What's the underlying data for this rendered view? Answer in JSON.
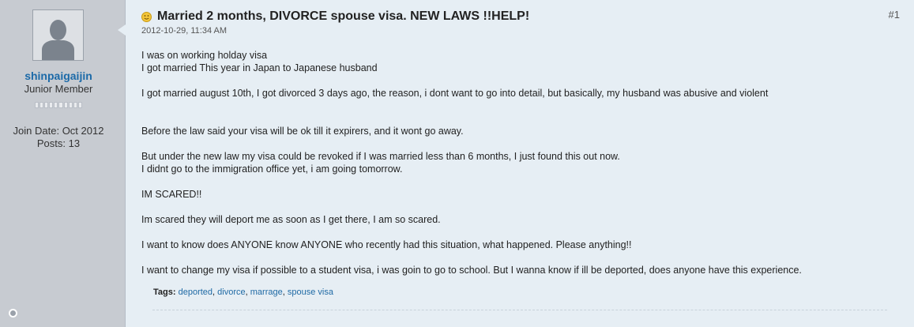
{
  "user": {
    "username": "shinpaigaijin",
    "title": "Junior Member",
    "reputation_segments": 10,
    "join_date": "Join Date: Oct 2012",
    "posts": "Posts: 13"
  },
  "post": {
    "counter": "#1",
    "title": "Married 2 months, DIVORCE spouse visa. NEW LAWS !!HELP!",
    "date": "2012-10-29, 11:34 AM",
    "body": [
      "I was on working holday visa",
      "I got married This year in Japan to Japanese husband",
      "I got married august 10th, I got divorced 3 days ago, the reason, i dont want to go into detail, but basically, my husband was abusive and violent",
      "Before the law said your visa will be ok till it expirers, and it wont go away.",
      "But under the new law my visa could be revoked if I was married less than 6 months, I just found this out now.",
      "I didnt go to the immigration office yet, i am going tomorrow.",
      "IM SCARED!!",
      "Im scared they will deport me as soon as I get there, I am so scared.",
      "I want to know does ANYONE know ANYONE who recently had this situation, what happened. Please anything!!",
      "I want to change my visa if possible to a student visa, i was goin to go to school. But I wanna know if ill be deported, does anyone have this experience."
    ],
    "tags_label": "Tags:",
    "tags": [
      "deported",
      "divorce",
      "marrage",
      "spouse visa"
    ]
  },
  "icons": {
    "post_icon": "smile-icon",
    "avatar": "default-avatar-icon",
    "status": "offline-status-icon"
  },
  "colors": {
    "username": "#1c6aa8",
    "link": "#1f6aa5",
    "sidebar": "#c7cbd1",
    "post_bg": "#e6eef4"
  }
}
